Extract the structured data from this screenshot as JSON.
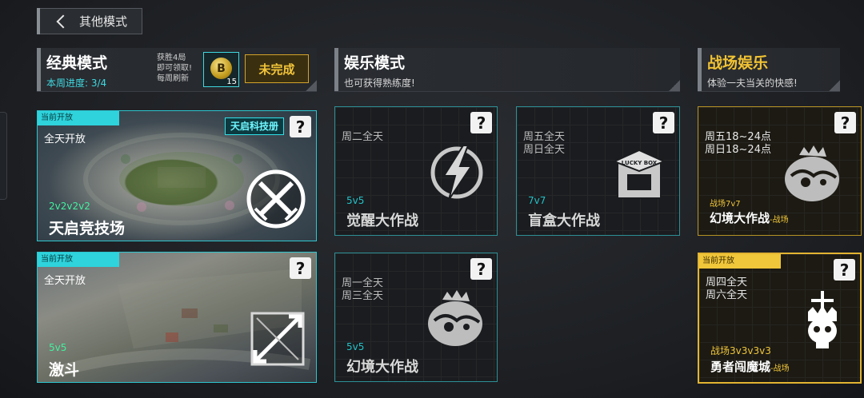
{
  "back": {
    "label": "其他模式"
  },
  "headers": {
    "classic": {
      "title": "经典模式",
      "subtitle": "本周进度: 3/4",
      "reward_note": [
        "获胜4局",
        "即可领取!",
        "每周刷新"
      ],
      "coin_count": "15",
      "status": "未完成"
    },
    "fun": {
      "title": "娱乐模式",
      "subtitle": "也可获得熟练度!"
    },
    "battle": {
      "title": "战场娱乐",
      "subtitle": "体验一夫当关的快感!"
    }
  },
  "cards": {
    "arena": {
      "badge": "当前开放",
      "time": "全天开放",
      "sponsor": "天启科技册",
      "mode": "2v2v2v2",
      "name": "天启竞技场"
    },
    "brawl": {
      "badge": "当前开放",
      "time": "全天开放",
      "mode": "5v5",
      "name": "激斗"
    },
    "awaken": {
      "time": [
        "周二全天"
      ],
      "mode": "5v5",
      "name": "觉醒大作战"
    },
    "blindbox": {
      "time": [
        "周五全天",
        "周日全天"
      ],
      "mode": "7v7",
      "name": "盲盒大作战"
    },
    "illusion": {
      "time": [
        "周一全天",
        "周三全天"
      ],
      "mode": "5v5",
      "name": "幻境大作战"
    },
    "illusion_battle": {
      "time": [
        "周五18~24点",
        "周日18~24点"
      ],
      "mode": "战场7v7",
      "name": "幻境大作战",
      "tag": "-战场"
    },
    "hero_castle": {
      "badge": "当前开放",
      "time": [
        "周四全天",
        "周六全天"
      ],
      "mode": "战场3v3v3v3",
      "name": "勇者闯魔城",
      "tag": "-战场"
    }
  },
  "help_symbol": "?",
  "coin_symbol": "B",
  "box_label": "LUCKY BOX"
}
